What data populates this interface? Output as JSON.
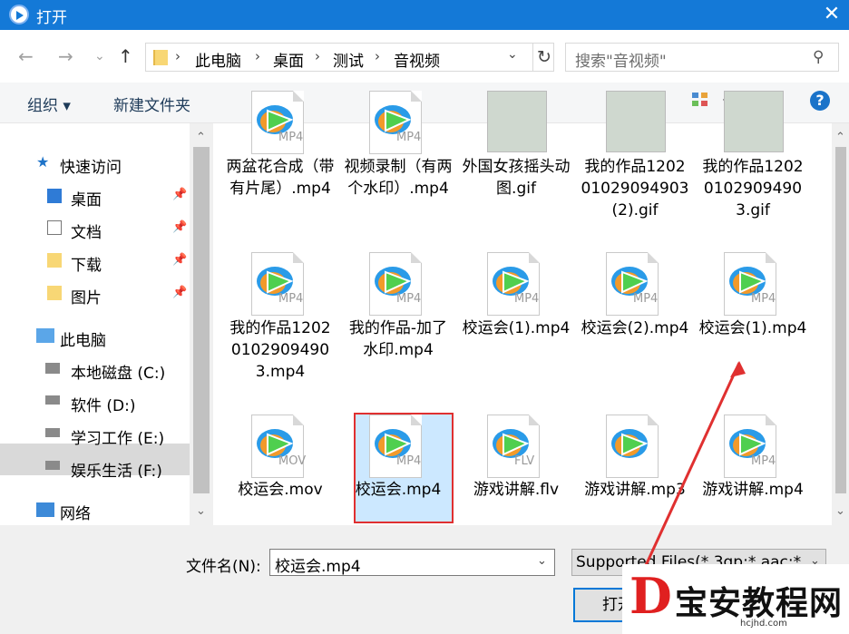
{
  "window": {
    "title": "打开",
    "close": "✕"
  },
  "nav": {
    "back": "←",
    "forward": "→",
    "recent": "⌄",
    "up": "↑"
  },
  "address": {
    "crumbs": [
      "此电脑",
      "桌面",
      "测试",
      "音视频"
    ],
    "sep": "›",
    "dropdown": "⌄",
    "refresh": "↻"
  },
  "search": {
    "placeholder": "搜索\"音视频\"",
    "icon": "⚲"
  },
  "toolbar": {
    "organize": "组织 ▾",
    "new_folder": "新建文件夹",
    "view_dd": "▾",
    "help": "?"
  },
  "sidebar": {
    "quick_access": "快速访问",
    "quick_items": [
      "桌面",
      "文档",
      "下载",
      "图片"
    ],
    "pin": "📌",
    "this_pc": "此电脑",
    "drives": [
      "本地磁盘 (C:)",
      "软件 (D:)",
      "学习工作 (E:)",
      "娱乐生活 (F:)"
    ],
    "network": "网络"
  },
  "files": {
    "row1": [
      {
        "name": "两盆花合成（带有片尾）.mp4",
        "ext": "MP4",
        "kind": "video"
      },
      {
        "name": "视频录制（有两个水印）.mp4",
        "ext": "MP4",
        "kind": "video"
      },
      {
        "name": "外国女孩摇头动图.gif",
        "ext": "",
        "kind": "image"
      },
      {
        "name": "我的作品120201029094903(2).gif",
        "ext": "",
        "kind": "image"
      },
      {
        "name": "我的作品120201029094903.gif",
        "ext": "",
        "kind": "image"
      }
    ],
    "row2": [
      {
        "name": "我的作品120201029094903.mp4",
        "ext": "MP4",
        "kind": "video"
      },
      {
        "name": "我的作品-加了水印.mp4",
        "ext": "MP4",
        "kind": "video"
      },
      {
        "name": "校运会(1).mp4",
        "ext": "MP4",
        "kind": "video"
      },
      {
        "name": "校运会(2).mp4",
        "ext": "MP4",
        "kind": "video"
      },
      {
        "name": "校运会(1).mp4",
        "ext": "MP4",
        "kind": "video"
      }
    ],
    "row3": [
      {
        "name": "校运会.mov",
        "ext": "MOV",
        "kind": "video"
      },
      {
        "name": "校运会.mp4",
        "ext": "MP4",
        "kind": "video",
        "selected": true
      },
      {
        "name": "游戏讲解.flv",
        "ext": "FLV",
        "kind": "video"
      },
      {
        "name": "游戏讲解.mp3",
        "ext": "",
        "kind": "audio"
      },
      {
        "name": "游戏讲解.mp4",
        "ext": "MP4",
        "kind": "video"
      }
    ]
  },
  "bottom": {
    "filename_label": "文件名(N):",
    "filename_value": "校运会.mp4",
    "filetype_value": "Supported Files(*.3gp;*.aac;*.",
    "dropdown": "⌄",
    "open": "打开"
  },
  "watermark": {
    "logo": "D",
    "text": "宝安教程网",
    "url": "hcjhd.com"
  },
  "colors": {
    "title_bar": "#1479d7",
    "selection": "#cce8ff",
    "highlight": "#e03030"
  }
}
